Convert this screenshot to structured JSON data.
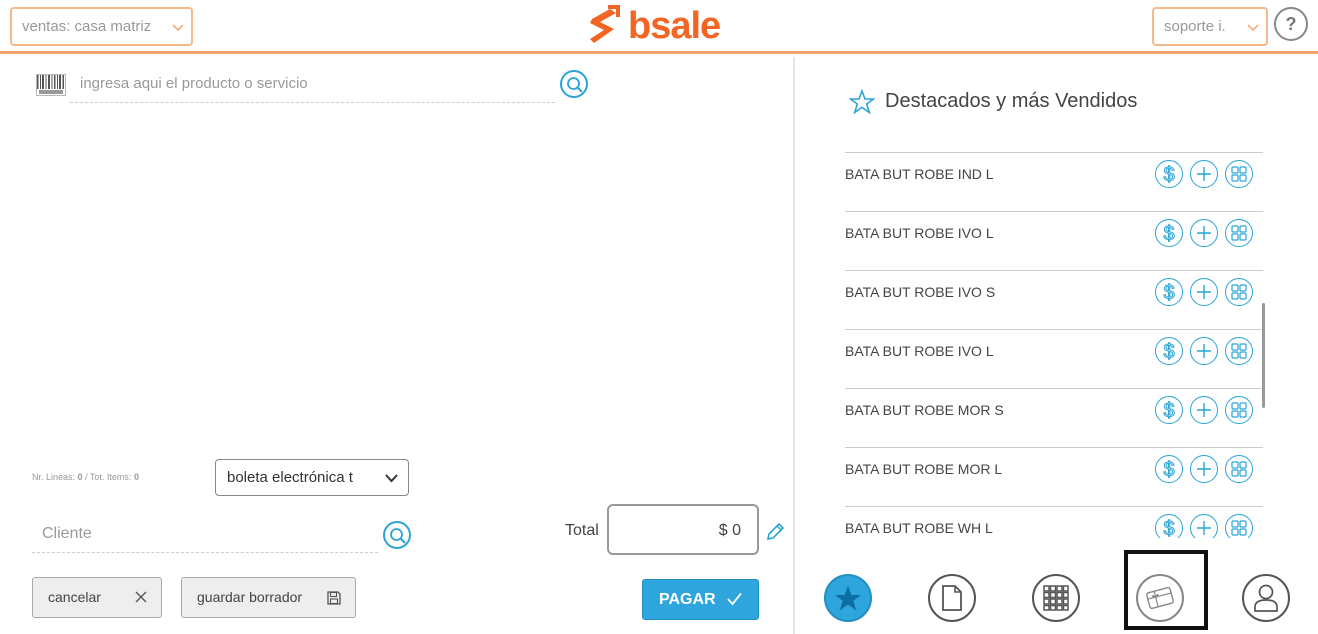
{
  "header": {
    "branch_select": "ventas: casa matriz",
    "user_select": "soporte i.",
    "help_label": "?",
    "logo_text": "bsale",
    "accent_color": "#f26522"
  },
  "sale": {
    "product_search_placeholder": "ingresa aqui el producto o servicio",
    "counter_lines_label": "Nr. Lineas:",
    "counter_lines_value": "0",
    "counter_items_label": "/ Tot. Items:",
    "counter_items_value": "0",
    "document_type": "boleta electrónica t",
    "client_placeholder": "Cliente",
    "total_label": "Total",
    "total_value": "$ 0",
    "cancel_label": "cancelar",
    "save_draft_label": "guardar borrador",
    "pay_label": "PAGAR",
    "pay_color": "#2ea6dd"
  },
  "featured": {
    "title": "Destacados y más Vendidos",
    "products": [
      {
        "name": "BATA BUT ROBE IND L"
      },
      {
        "name": "BATA BUT ROBE IVO L"
      },
      {
        "name": "BATA BUT ROBE IVO S"
      },
      {
        "name": "BATA BUT ROBE IVO L"
      },
      {
        "name": "BATA BUT ROBE MOR S"
      },
      {
        "name": "BATA BUT ROBE MOR L"
      },
      {
        "name": "BATA BUT ROBE WH L"
      }
    ]
  },
  "bottom_nav": {
    "items": [
      {
        "icon": "star-icon",
        "active": true
      },
      {
        "icon": "document-icon",
        "active": false
      },
      {
        "icon": "grid-icon",
        "active": false
      },
      {
        "icon": "gift-card-icon",
        "active": false,
        "highlighted": true
      },
      {
        "icon": "user-icon",
        "active": false
      }
    ]
  }
}
